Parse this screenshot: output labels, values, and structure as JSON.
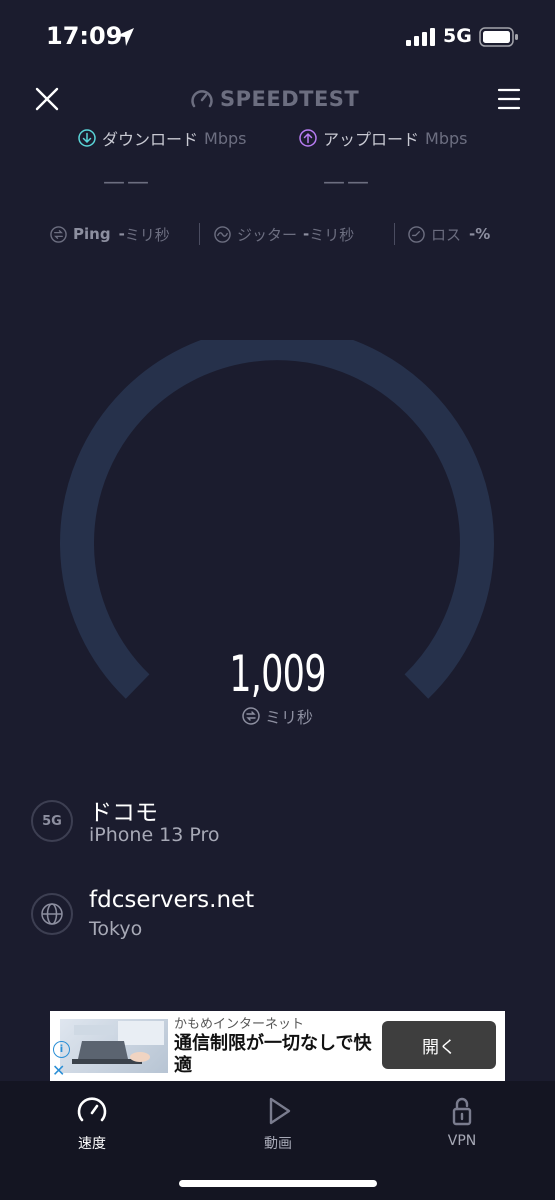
{
  "status_bar": {
    "time": "17:09",
    "network": "5G"
  },
  "header": {
    "logo_text": "SPEEDTEST"
  },
  "download": {
    "label": "ダウンロード",
    "unit": "Mbps",
    "value": "——"
  },
  "upload": {
    "label": "アップロード",
    "unit": "Mbps",
    "value": "——"
  },
  "stats": {
    "ping_label": "Ping",
    "ping_value": "-",
    "ping_unit": "ミリ秒",
    "jitter_label": "ジッター",
    "jitter_value": "-",
    "jitter_unit": "ミリ秒",
    "loss_label": "ロス",
    "loss_value": "-%"
  },
  "gauge": {
    "value": "1,009",
    "unit": "ミリ秒"
  },
  "provider": {
    "badge": "5G",
    "name": "ドコモ",
    "device": "iPhone 13 Pro"
  },
  "server": {
    "host": "fdcservers.net",
    "location": "Tokyo"
  },
  "ad": {
    "advertiser": "かもめインターネット",
    "title": "通信制限が一切なしで快適",
    "button": "開く"
  },
  "tabs": [
    {
      "label": "速度",
      "icon": "speedometer-icon",
      "active": true
    },
    {
      "label": "動画",
      "icon": "play-icon",
      "active": false
    },
    {
      "label": "VPN",
      "icon": "lock-icon",
      "active": false
    }
  ],
  "colors": {
    "background": "#1b1c2e",
    "gauge_track": "#26314b",
    "download_accent": "#5ad5d8",
    "upload_accent": "#b77cf2",
    "muted": "#6c6e80"
  }
}
